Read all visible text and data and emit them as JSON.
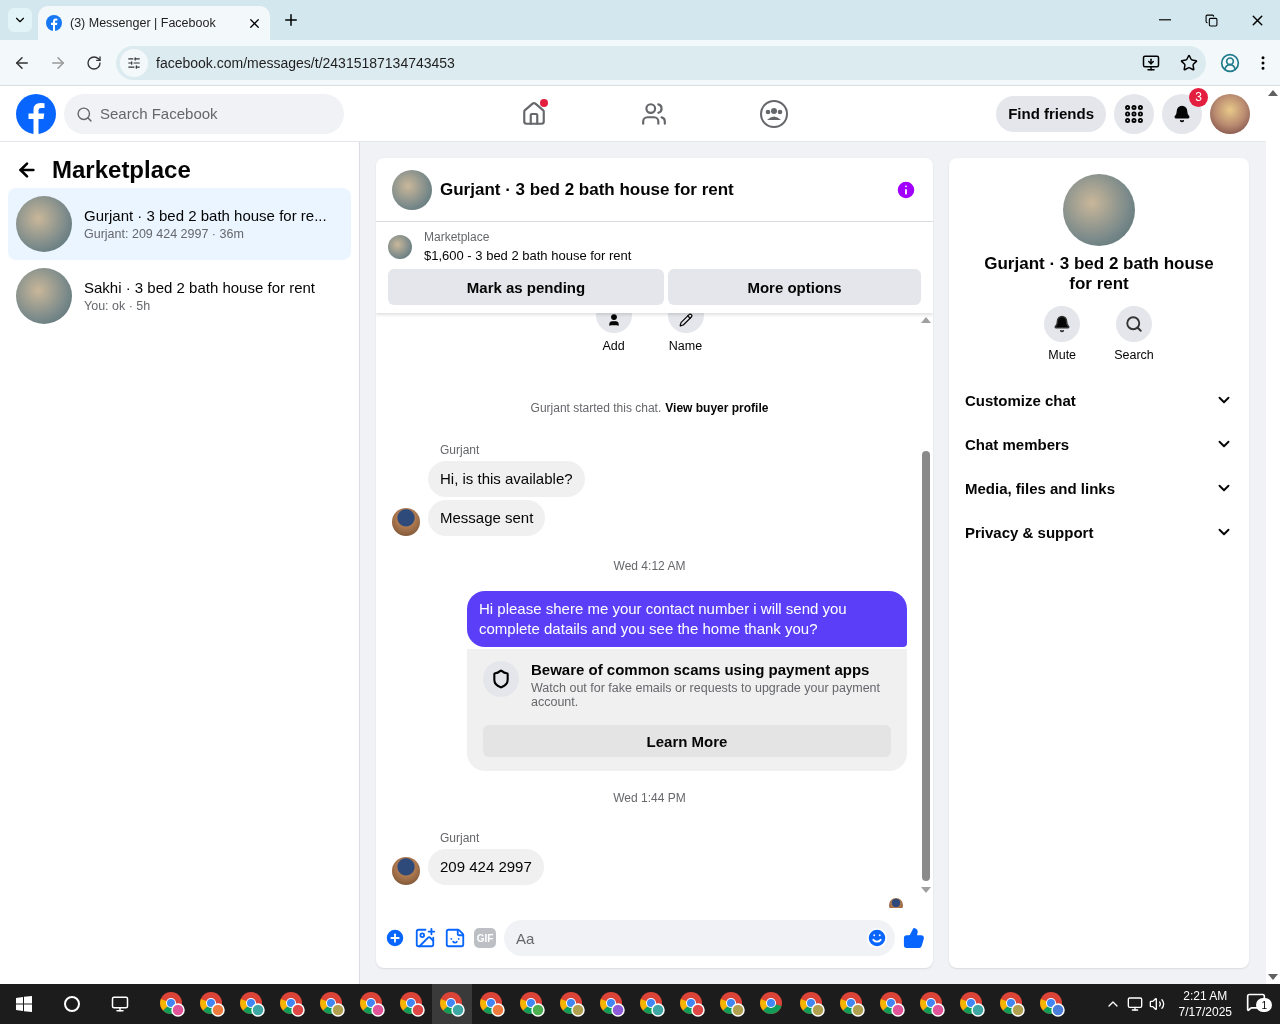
{
  "browser": {
    "tab_title": "(3) Messenger | Facebook",
    "url": "facebook.com/messages/t/24315187134743453"
  },
  "header": {
    "search_placeholder": "Search Facebook",
    "nav": [
      {
        "kind": "home",
        "dot": true
      },
      {
        "kind": "friends",
        "dot": false
      },
      {
        "kind": "groups",
        "dot": false
      }
    ],
    "find_friends": "Find friends",
    "notification_count": "3"
  },
  "sidebar": {
    "title": "Marketplace",
    "conversations": [
      {
        "title": "Gurjant · 3 bed 2 bath house for re...",
        "preview": "Gurjant: 209 424 2997 · 36m",
        "selected": true
      },
      {
        "title": "Sakhi · 3 bed 2 bath house for rent",
        "preview": "You: ok · 5h",
        "selected": false
      }
    ]
  },
  "chat": {
    "title": "Gurjant · 3 bed 2 bath house for rent",
    "listing": {
      "label": "Marketplace",
      "price_line": "$1,600 - 3 bed 2 bath house for rent"
    },
    "actions": [
      "Mark as pending",
      "More options"
    ],
    "quick_actions": [
      {
        "kind": "add",
        "label": "Add"
      },
      {
        "kind": "name",
        "label": "Name"
      }
    ],
    "messages": [
      {
        "kind": "system",
        "text": "Gurjant started this chat.",
        "link": "View buyer profile"
      },
      {
        "kind": "sender",
        "text": "Gurjant"
      },
      {
        "kind": "incoming",
        "text": "Hi, is this available?",
        "avatar": false
      },
      {
        "kind": "incoming",
        "text": "Message sent",
        "avatar": true
      },
      {
        "kind": "timestamp",
        "text": "Wed 4:12 AM"
      },
      {
        "kind": "outgoing",
        "text": "Hi please shere me your contact number i will send you complete datails and you see the home thank you?"
      },
      {
        "kind": "notice",
        "title": "Beware of common scams using payment apps",
        "body": "Watch out for fake emails or requests to upgrade your payment account.",
        "button": "Learn More"
      },
      {
        "kind": "timestamp",
        "text": "Wed 1:44 PM"
      },
      {
        "kind": "sender",
        "text": "Gurjant"
      },
      {
        "kind": "incoming",
        "text": "209 424 2997",
        "avatar": true
      }
    ],
    "composer": {
      "gif": "GIF",
      "placeholder": "Aa"
    }
  },
  "details": {
    "title": "Gurjant · 3 bed 2 bath house for rent",
    "actions": [
      {
        "kind": "mute",
        "label": "Mute"
      },
      {
        "kind": "search",
        "label": "Search"
      }
    ],
    "sections": [
      {
        "label": "Customize chat",
        "expanded": false
      },
      {
        "label": "Chat members",
        "expanded": false
      },
      {
        "label": "Media, files and links",
        "expanded": false
      },
      {
        "label": "Privacy & support",
        "expanded": false
      }
    ]
  },
  "taskbar": {
    "apps": [
      {
        "kind": "profile",
        "color": "#e0559a",
        "selected": false
      },
      {
        "kind": "profile",
        "color": "#f07b3f",
        "selected": false
      },
      {
        "kind": "profile",
        "color": "#3fa6a6",
        "selected": false
      },
      {
        "kind": "profile",
        "color": "#e04848",
        "selected": false
      },
      {
        "kind": "profile",
        "color": "#b0a050",
        "selected": false
      },
      {
        "kind": "profile",
        "color": "#e0559a",
        "selected": false
      },
      {
        "kind": "profile",
        "color": "#e04848",
        "selected": false
      },
      {
        "kind": "profile",
        "color": "#3fa6a6",
        "selected": true
      },
      {
        "kind": "profile",
        "color": "#f07b3f",
        "selected": false
      },
      {
        "kind": "profile",
        "color": "#4caf50",
        "selected": false
      },
      {
        "kind": "profile",
        "color": "#b0a050",
        "selected": false
      },
      {
        "kind": "profile",
        "color": "#8e5cd9",
        "selected": false
      },
      {
        "kind": "profile",
        "color": "#3fa6a6",
        "selected": false
      },
      {
        "kind": "profile",
        "color": "#e04848",
        "selected": false
      },
      {
        "kind": "profile",
        "color": "#b0a050",
        "selected": false
      },
      {
        "kind": "plain",
        "selected": false
      },
      {
        "kind": "profile",
        "color": "#b0a050",
        "selected": false
      },
      {
        "kind": "profile",
        "color": "#b0a050",
        "selected": false
      },
      {
        "kind": "profile",
        "color": "#e0559a",
        "selected": false
      },
      {
        "kind": "profile",
        "color": "#e0559a",
        "selected": false
      },
      {
        "kind": "profile",
        "color": "#3fa6a6",
        "selected": false
      },
      {
        "kind": "profile",
        "color": "#b0a050",
        "selected": false
      },
      {
        "kind": "profile",
        "color": "#4a7fd9",
        "selected": false
      }
    ],
    "time": "2:21 AM",
    "date": "7/17/2025",
    "notification_count": "1"
  }
}
